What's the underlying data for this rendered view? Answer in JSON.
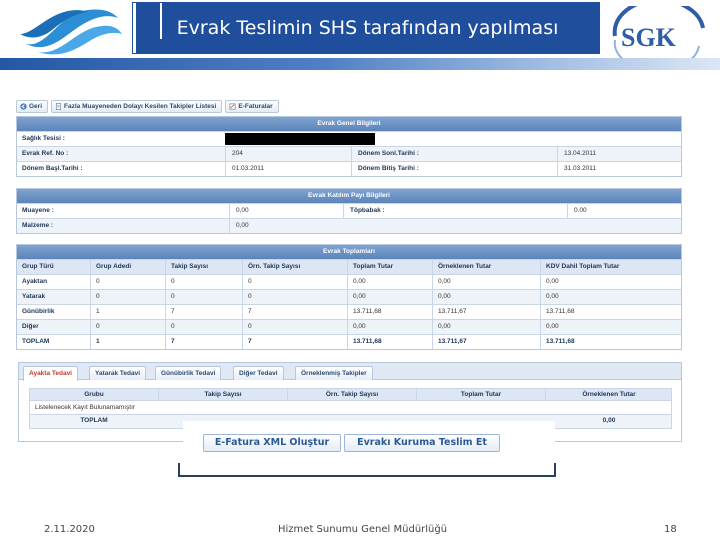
{
  "slide": {
    "title": "Evrak Teslimin SHS tarafından yapılması",
    "sgk_logo_text": "SGK",
    "footer_date": "2.11.2020",
    "footer_org": "Hizmet Sunumu Genel Müdürlüğü",
    "footer_page": "18",
    "brand_color": "#1f4f9c"
  },
  "toolbar": {
    "back_label": "Geri",
    "excess_label": "Fazla Muayeneden Dolayı Kesilen Takipler Listesi",
    "einvoices_label": "E-Faturalar"
  },
  "general": {
    "header": "Evrak Genel Bilgileri",
    "facility_label": "Sağlık Tesisi :",
    "facility_value": "",
    "ref_label": "Evrak Ref. No :",
    "ref_value": "204",
    "period_end_label": "Dönem Sonl.Tarihi :",
    "period_end_value": "13.04.2011",
    "period_start_label": "Dönem Başl.Tarihi :",
    "period_start_value": "01.03.2011",
    "period_finish_label": "Dönem Bitiş Tarihi :",
    "period_finish_value": "31.03.2011"
  },
  "contribution": {
    "header": "Evrak Katılım Payı Bilgileri",
    "exam_label": "Muayene :",
    "exam_value": "0,00",
    "lump_label": "Töpbabak :",
    "lump_value": "0.00",
    "material_label": "Malzeme :",
    "material_value": "0,00"
  },
  "totals": {
    "header": "Evrak Toplamları",
    "columns": [
      "Grup Türü",
      "Grup Adedi",
      "Takip Sayısı",
      "Örn. Takip Sayısı",
      "Toplam Tutar",
      "Örneklenen Tutar",
      "KDV Dahil Toplam Tutar"
    ],
    "rows": [
      [
        "Ayaktan",
        "0",
        "0",
        "0",
        "0,00",
        "0,00",
        "0,00"
      ],
      [
        "Yatarak",
        "0",
        "0",
        "0",
        "0,00",
        "0,00",
        "0,00"
      ],
      [
        "Günübirlik",
        "1",
        "7",
        "7",
        "13.711,68",
        "13.711,67",
        "13.711,68"
      ],
      [
        "Diğer",
        "0",
        "0",
        "0",
        "0,00",
        "0,00",
        "0,00"
      ],
      [
        "TOPLAM",
        "1",
        "7",
        "7",
        "13.711,68",
        "13.711,67",
        "13.711,68"
      ]
    ]
  },
  "tabs": {
    "items": [
      "Ayakta Tedavi",
      "Yatarak Tedavi",
      "Günübirlik Tedavi",
      "Diğer Tedavi",
      "Örneklenmiş Takipler"
    ],
    "active": "Ayakta Tedavi"
  },
  "inner": {
    "columns": [
      "Grubu",
      "Takip Sayısı",
      "Örn. Takip Sayısı",
      "Toplam Tutar",
      "Örneklenen Tutar"
    ],
    "empty_message": "Listelenecek Kayıt Bulunamamıştır",
    "total_label": "TOPLAM",
    "total_value": "0,00"
  },
  "actions": {
    "xml_label": "E-Fatura XML Oluştur",
    "deliver_label": "Evrakı Kuruma Teslim Et"
  }
}
